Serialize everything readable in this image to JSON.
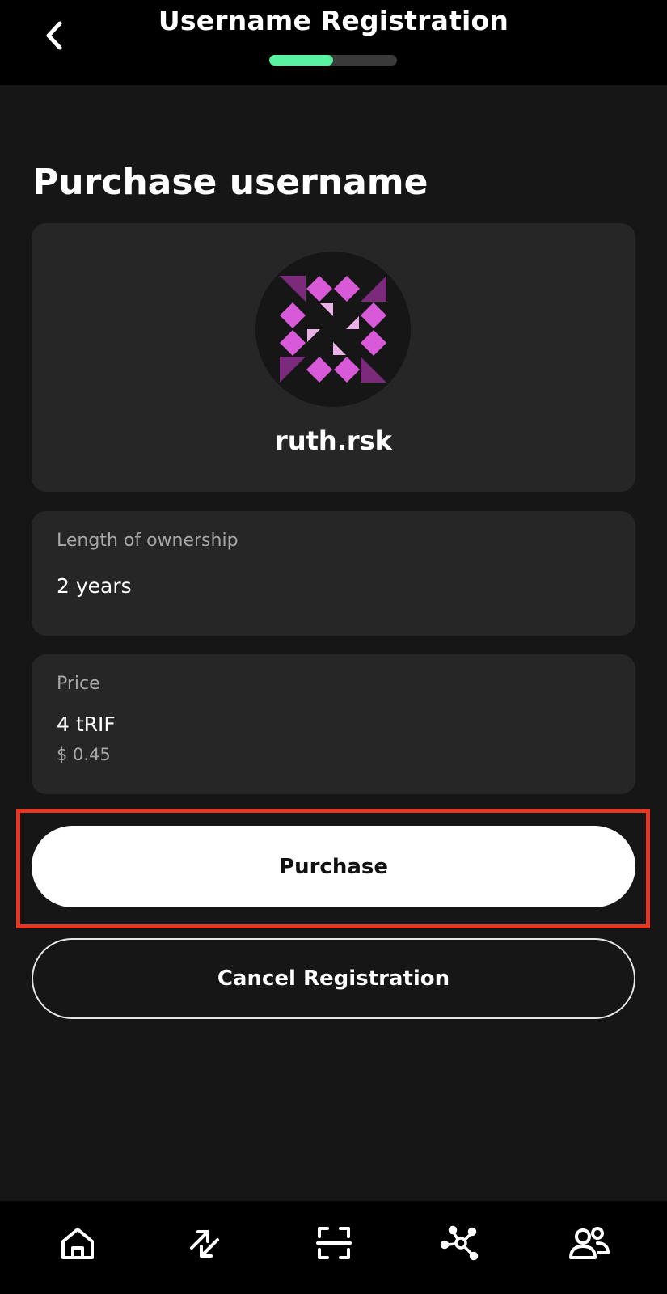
{
  "header": {
    "title": "Username Registration",
    "back_icon": "chevron-left-icon",
    "progress": {
      "current_step": 1,
      "total_steps": 2,
      "fill_fraction": 0.5,
      "fill_color": "#59f2a0"
    }
  },
  "main": {
    "heading": "Purchase username",
    "avatar_card": {
      "username": "ruth.rsk",
      "avatar_icon": "identicon-avatar",
      "avatar_colors": [
        "#d95ad8",
        "#7b2a7c",
        "#eab0e8"
      ]
    },
    "ownership_card": {
      "label": "Length of ownership",
      "value": "2 years"
    },
    "price_card": {
      "label": "Price",
      "value": "4 tRIF",
      "fiat_value": "$ 0.45"
    },
    "purchase_button": {
      "label": "Purchase",
      "highlighted": true,
      "highlight_color": "#e83623"
    },
    "cancel_button": {
      "label": "Cancel Registration"
    }
  },
  "bottom_nav": {
    "items": [
      {
        "icon": "home-icon"
      },
      {
        "icon": "transfer-arrows-icon"
      },
      {
        "icon": "scan-icon"
      },
      {
        "icon": "network-icon"
      },
      {
        "icon": "contacts-icon"
      }
    ]
  }
}
